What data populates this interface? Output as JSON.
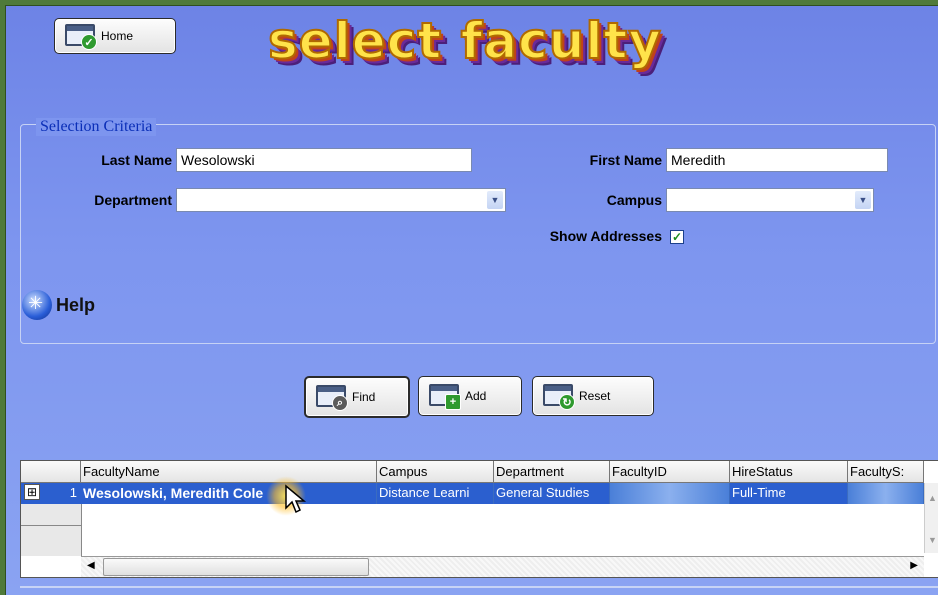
{
  "home_button": {
    "label": "Home",
    "icon": "window-check-icon"
  },
  "title": "select faculty",
  "criteria": {
    "legend": "Selection Criteria",
    "last_name_label": "Last Name",
    "last_name_value": "Wesolowski",
    "first_name_label": "First Name",
    "first_name_value": "Meredith",
    "department_label": "Department",
    "department_value": "",
    "campus_label": "Campus",
    "campus_value": "",
    "show_addresses_label": "Show Addresses",
    "show_addresses_checked": true,
    "help_label": "Help"
  },
  "actions": {
    "find_label": "Find",
    "add_label": "Add",
    "reset_label": "Reset"
  },
  "grid": {
    "columns": [
      "FacultyName",
      "Campus",
      "Department",
      "FacultyID",
      "HireStatus",
      "FacultyS:"
    ],
    "rows": [
      {
        "expander": "⊞",
        "row_number": "1",
        "FacultyName": "Wesolowski, Meredith Cole",
        "Campus": "Distance Learni",
        "Department": "General Studies",
        "FacultyID": "",
        "HireStatus": "Full-Time",
        "FacultyS": ""
      }
    ]
  },
  "colors": {
    "background": "#7d95ef",
    "selected_row": "#2b5fcf",
    "title_fill": "#ffe34a",
    "legend_text": "#0b2fb8"
  }
}
